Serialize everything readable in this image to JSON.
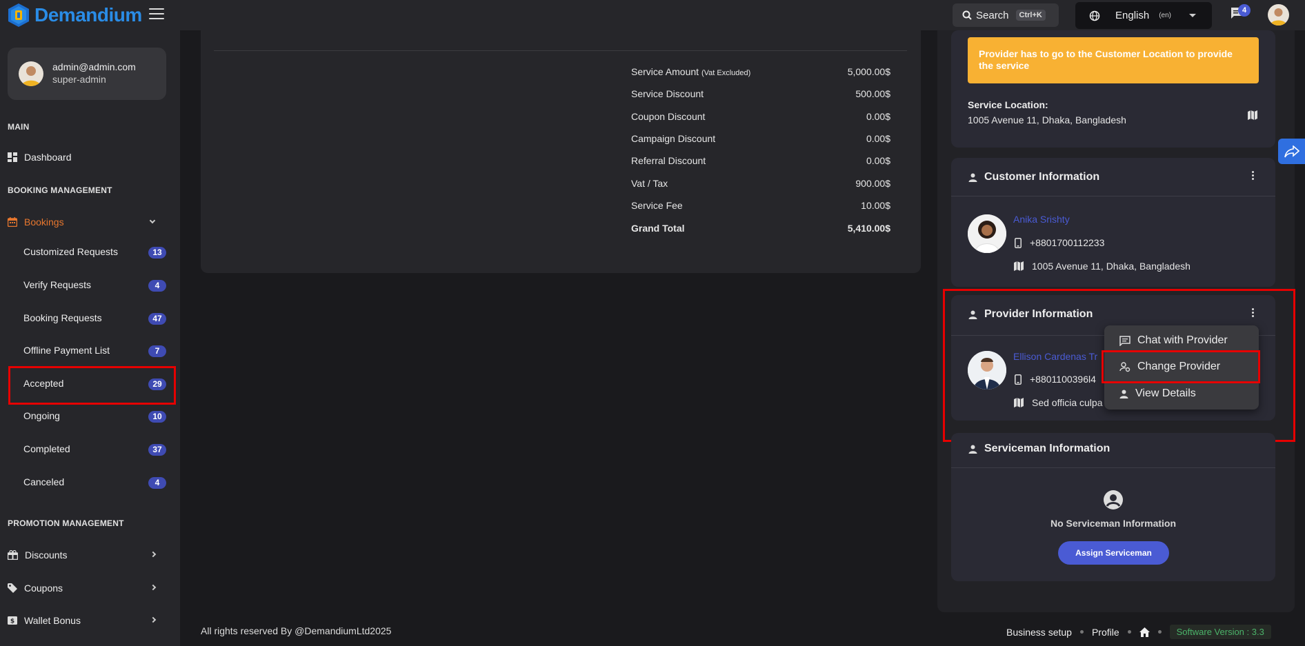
{
  "brand": {
    "name": "Demandium"
  },
  "topbar": {
    "search_label": "Search",
    "search_shortcut": "Ctrl+K",
    "language": "English",
    "language_code": "(en)",
    "notification_count": "4"
  },
  "user": {
    "email": "admin@admin.com",
    "role": "super-admin"
  },
  "sidebar": {
    "section_main": "MAIN",
    "dashboard": "Dashboard",
    "section_booking": "BOOKING MANAGEMENT",
    "bookings": "Bookings",
    "sub_items": [
      {
        "label": "Customized Requests",
        "count": "13"
      },
      {
        "label": "Verify Requests",
        "count": "4"
      },
      {
        "label": "Booking Requests",
        "count": "47"
      },
      {
        "label": "Offline Payment List",
        "count": "7"
      },
      {
        "label": "Accepted",
        "count": "29"
      },
      {
        "label": "Ongoing",
        "count": "10"
      },
      {
        "label": "Completed",
        "count": "37"
      },
      {
        "label": "Canceled",
        "count": "4"
      }
    ],
    "section_promotion": "PROMOTION MANAGEMENT",
    "promo_items": [
      {
        "label": "Discounts"
      },
      {
        "label": "Coupons"
      },
      {
        "label": "Wallet Bonus"
      }
    ]
  },
  "summary": {
    "rows": [
      {
        "label": "Service Amount",
        "note": "(Vat Excluded)",
        "value": "5,000.00$"
      },
      {
        "label": "Service Discount",
        "note": "",
        "value": "500.00$"
      },
      {
        "label": "Coupon Discount",
        "note": "",
        "value": "0.00$"
      },
      {
        "label": "Campaign Discount",
        "note": "",
        "value": "0.00$"
      },
      {
        "label": "Referral Discount",
        "note": "",
        "value": "0.00$"
      },
      {
        "label": "Vat / Tax",
        "note": "",
        "value": "900.00$"
      },
      {
        "label": "Service Fee",
        "note": "",
        "value": "10.00$"
      },
      {
        "label": "Grand Total",
        "note": "",
        "value": "5,410.00$"
      }
    ]
  },
  "location_card": {
    "notice": "Provider has to go to the Customer Location to provide the service",
    "label": "Service Location:",
    "address": "1005 Avenue 11, Dhaka, Bangladesh"
  },
  "customer": {
    "title": "Customer Information",
    "name": "Anika Srishty",
    "phone": "+8801700112233",
    "address": "1005 Avenue 11, Dhaka, Bangladesh"
  },
  "provider": {
    "title": "Provider Information",
    "name": "Ellison Cardenas Tr",
    "phone": "+8801100396l4",
    "address": "Sed officia culpa"
  },
  "provider_menu": {
    "chat": "Chat with Provider",
    "change": "Change Provider",
    "details": "View Details"
  },
  "serviceman": {
    "title": "Serviceman Information",
    "empty": "No Serviceman Information",
    "assign": "Assign Serviceman"
  },
  "footer": {
    "copyright": "All rights reserved By @DemandiumLtd2025",
    "business_setup": "Business setup",
    "profile": "Profile",
    "version": "Software Version : 3.3"
  },
  "colors": {
    "accent": "#4a5bd4",
    "active": "#e8772e",
    "notice": "#f8b133",
    "highlight": "#e60000"
  }
}
